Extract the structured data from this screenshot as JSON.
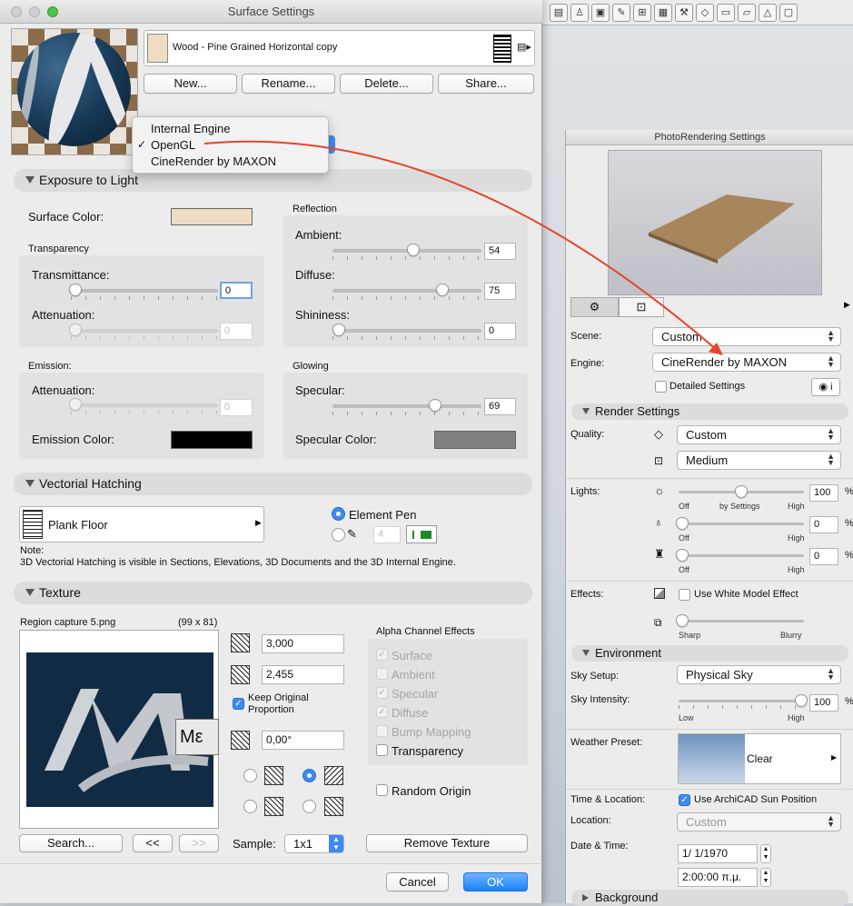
{
  "window": {
    "title": "Surface Settings"
  },
  "material": {
    "name": "Wood - Pine Grained Horizontal copy"
  },
  "buttons": {
    "new": "New...",
    "rename": "Rename...",
    "delete": "Delete...",
    "share": "Share...",
    "search": "Search...",
    "prev": "<<",
    "next": ">>",
    "remove_texture": "Remove Texture",
    "cancel": "Cancel",
    "ok": "OK"
  },
  "engine_menu": {
    "items": [
      {
        "label": "Internal Engine",
        "checked": false
      },
      {
        "label": "OpenGL",
        "checked": true
      },
      {
        "label": "CineRender by MAXON",
        "checked": false
      }
    ],
    "check": "✓"
  },
  "exposure": {
    "title": "Exposure to Light",
    "surface_color_label": "Surface Color:",
    "surface_color": "#efdcc4",
    "transparency_title": "Transparency",
    "transmittance_label": "Transmittance:",
    "transmittance": "0",
    "attenuation_label": "Attenuation:",
    "attenuation": "0",
    "emission_title": "Emission:",
    "emission_attenuation_label": "Attenuation:",
    "emission_attenuation": "0",
    "emission_color_label": "Emission Color:",
    "emission_color": "#000000",
    "reflection_title": "Reflection",
    "ambient_label": "Ambient:",
    "ambient": "54",
    "diffuse_label": "Diffuse:",
    "diffuse": "75",
    "shininess_label": "Shininess:",
    "shininess": "0",
    "glowing_title": "Glowing",
    "specular_label": "Specular:",
    "specular": "69",
    "specular_color_label": "Specular Color:",
    "specular_color": "#808080"
  },
  "hatching": {
    "title": "Vectorial Hatching",
    "pattern": "Plank Floor",
    "element_pen_label": "Element Pen",
    "pen_number": "4",
    "note_title": "Note:",
    "note": "3D Vectorial Hatching is visible in Sections, Elevations, 3D Documents and the 3D Internal Engine."
  },
  "texture": {
    "title": "Texture",
    "file": "Region capture 5.png",
    "size": "(99 x 81)",
    "preview_text": "Με",
    "width": "3,000",
    "height": "2,455",
    "keep_proportion": "Keep Original Proportion",
    "angle": "0,00°",
    "random_origin": "Random Origin",
    "sample_label": "Sample:",
    "sample": "1x1",
    "alpha_title": "Alpha Channel Effects",
    "alpha": [
      {
        "label": "Surface",
        "checked": true,
        "enabled": false
      },
      {
        "label": "Ambient",
        "checked": false,
        "enabled": false
      },
      {
        "label": "Specular",
        "checked": true,
        "enabled": false
      },
      {
        "label": "Diffuse",
        "checked": true,
        "enabled": false
      },
      {
        "label": "Bump Mapping",
        "checked": false,
        "enabled": false
      },
      {
        "label": "Transparency",
        "checked": false,
        "enabled": true
      }
    ]
  },
  "photo": {
    "title": "PhotoRendering Settings",
    "scene_label": "Scene:",
    "scene": "Custom",
    "engine_label": "Engine:",
    "engine": "CineRender by MAXON",
    "detailed": "Detailed Settings",
    "render_settings": "Render Settings",
    "quality_label": "Quality:",
    "quality": "Custom",
    "quality2": "Medium",
    "lights_label": "Lights:",
    "light1": "100",
    "light2": "0",
    "light3": "0",
    "pct": "%",
    "off": "Off",
    "by_settings": "by Settings",
    "high": "High",
    "effects_label": "Effects:",
    "white_model": "Use White Model Effect",
    "sharp": "Sharp",
    "blurry": "Blurry",
    "environment": "Environment",
    "sky_setup_label": "Sky Setup:",
    "sky_setup": "Physical Sky",
    "sky_intensity_label": "Sky Intensity:",
    "sky_intensity": "100",
    "low": "Low",
    "weather_label": "Weather Preset:",
    "weather": "Clear",
    "time_loc_label": "Time & Location:",
    "sun_position": "Use ArchiCAD Sun Position",
    "location_label": "Location:",
    "location": "Custom",
    "date_label": "Date & Time:",
    "date": "1/  1/1970",
    "time": "2:00:00 π.μ.",
    "background": "Background"
  }
}
